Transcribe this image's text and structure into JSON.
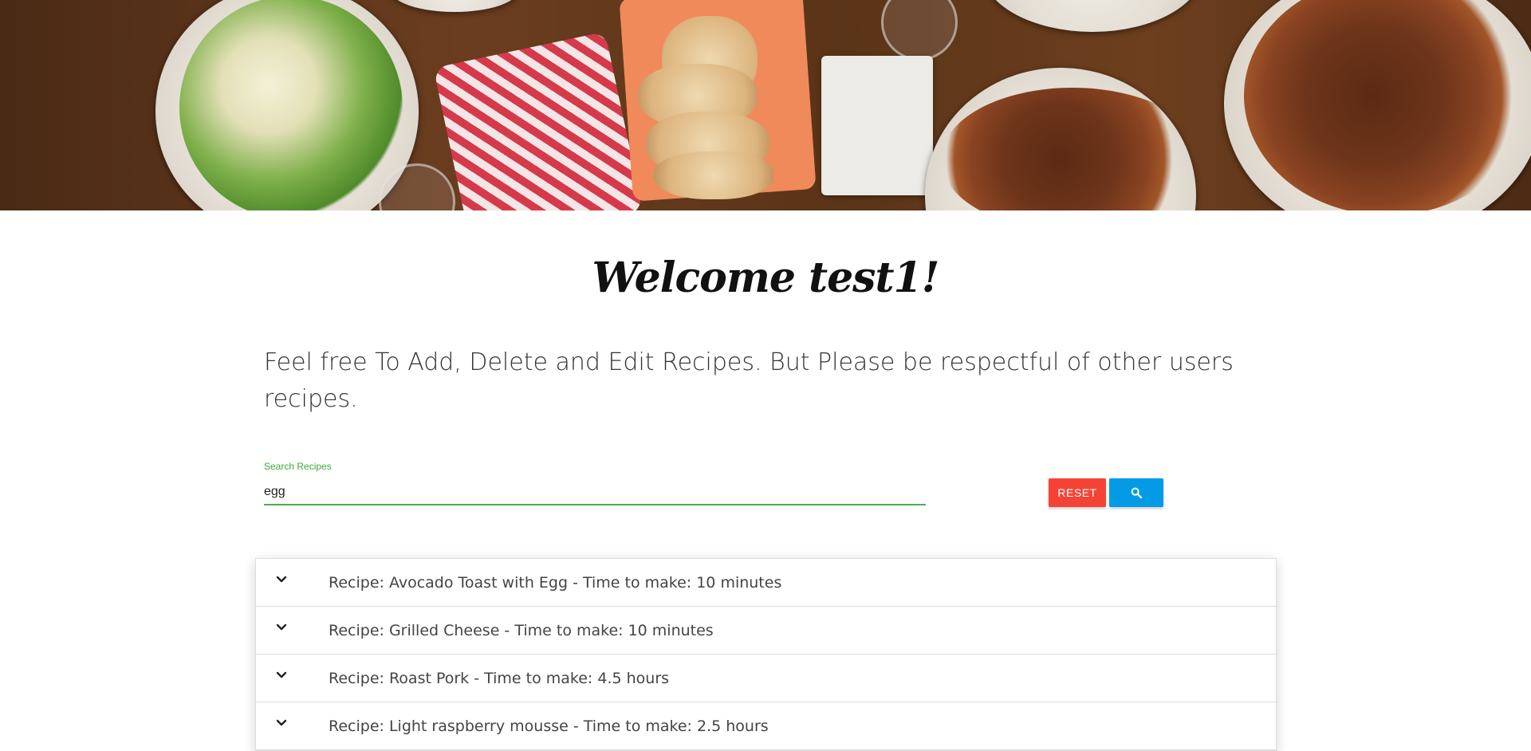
{
  "hero": {
    "image": "food-table-banner"
  },
  "welcome_title": "Welcome test1!",
  "intro_text": "Feel free To Add, Delete and Edit Recipes. But Please be respectful of other users recipes.",
  "search": {
    "label": "Search Recipes",
    "value": "egg"
  },
  "buttons": {
    "reset_label": "RESET",
    "search_icon": "search-icon"
  },
  "colors": {
    "reset": "#f44336",
    "search": "#039be5",
    "input_accent": "#4caf50"
  },
  "recipes": [
    {
      "label": "Recipe: Avocado Toast with Egg - Time to make: 10 minutes"
    },
    {
      "label": "Recipe: Grilled Cheese - Time to make: 10 minutes"
    },
    {
      "label": "Recipe: Roast Pork - Time to make: 4.5 hours"
    },
    {
      "label": "Recipe: Light raspberry mousse - Time to make: 2.5 hours"
    }
  ]
}
